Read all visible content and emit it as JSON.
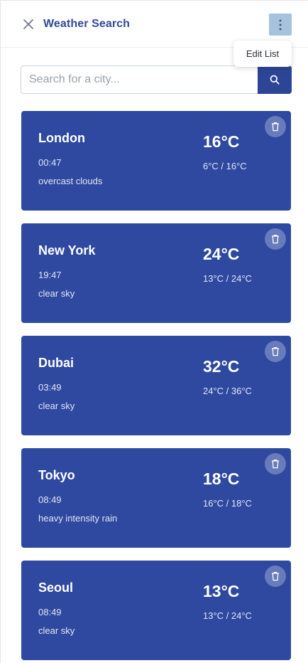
{
  "header": {
    "title": "Weather Search",
    "close_icon": "close-icon",
    "menu_icon": "more-vertical-icon"
  },
  "menu": {
    "items": [
      {
        "label": "Edit List"
      }
    ]
  },
  "search": {
    "placeholder": "Search for a city...",
    "value": "",
    "button_icon": "search-icon"
  },
  "cards": [
    {
      "city": "London",
      "time": "00:47",
      "description": "overcast clouds",
      "temp": "16°C",
      "range": "6°C / 16°C"
    },
    {
      "city": "New York",
      "time": "19:47",
      "description": "clear sky",
      "temp": "24°C",
      "range": "13°C / 24°C"
    },
    {
      "city": "Dubai",
      "time": "03:49",
      "description": "clear sky",
      "temp": "32°C",
      "range": "24°C / 36°C"
    },
    {
      "city": "Tokyo",
      "time": "08:49",
      "description": "heavy intensity rain",
      "temp": "18°C",
      "range": "16°C / 18°C"
    },
    {
      "city": "Seoul",
      "time": "08:49",
      "description": "clear sky",
      "temp": "13°C",
      "range": "13°C / 24°C"
    }
  ],
  "colors": {
    "accent": "#2f48a0",
    "title": "#2f4a97",
    "menu_button": "#a7c2dc"
  }
}
